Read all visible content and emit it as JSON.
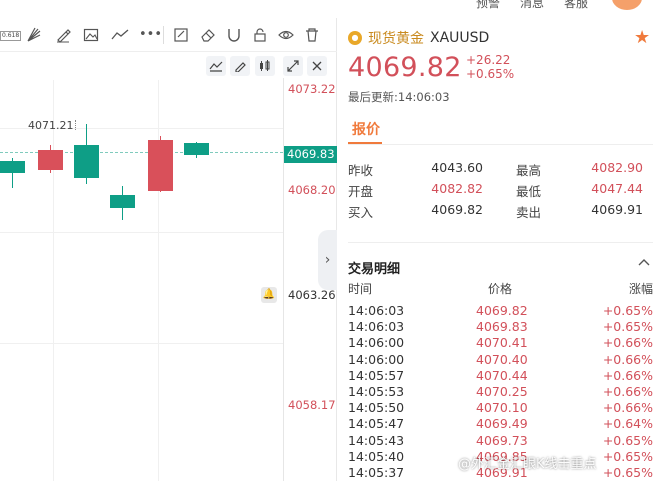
{
  "nav": {
    "items": [
      {
        "id": "forecast",
        "label": "预警"
      },
      {
        "id": "news",
        "label": "消息"
      },
      {
        "id": "service",
        "label": "客服"
      }
    ]
  },
  "toolbar": {
    "fib_label": "0.618"
  },
  "chart": {
    "axis_labels": [
      "4073.22",
      "4068.20",
      "4063.26",
      "4058.17"
    ],
    "last_price_tag": "4069.83",
    "high_annotation": "4071.21",
    "candles": [
      {
        "color": "up"
      },
      {
        "color": "down"
      },
      {
        "color": "up"
      },
      {
        "color": "up"
      },
      {
        "color": "down"
      },
      {
        "color": "up"
      }
    ]
  },
  "colors": {
    "up": "#0e9e86",
    "down": "#d9505a",
    "accent": "#f07a3c",
    "price_red": "#d2505a"
  },
  "quote": {
    "name": "现货黄金",
    "code": "XAUUSD",
    "price": "4069.82",
    "change": "+26.22",
    "change_pct": "+0.65%",
    "updated": "最后更新:14:06:03",
    "tab": "报价",
    "stats": [
      {
        "l1": "昨收",
        "v1": "4043.60",
        "l2": "最高",
        "v2": "4082.90",
        "c1": "dark",
        "c2": "red"
      },
      {
        "l1": "开盘",
        "v1": "4082.82",
        "l2": "最低",
        "v2": "4047.44",
        "c1": "red",
        "c2": "red"
      },
      {
        "l1": "买入",
        "v1": "4069.82",
        "l2": "卖出",
        "v2": "4069.91",
        "c1": "dark",
        "c2": "dark"
      }
    ],
    "trades_title": "交易明细",
    "trades_headers": {
      "time": "时间",
      "price": "价格",
      "chg": "涨幅"
    },
    "trades": [
      {
        "time": "14:06:03",
        "price": "4069.82",
        "chg": "+0.65%"
      },
      {
        "time": "14:06:03",
        "price": "4069.83",
        "chg": "+0.65%"
      },
      {
        "time": "14:06:00",
        "price": "4070.41",
        "chg": "+0.66%"
      },
      {
        "time": "14:06:00",
        "price": "4070.40",
        "chg": "+0.66%"
      },
      {
        "time": "14:05:57",
        "price": "4070.44",
        "chg": "+0.66%"
      },
      {
        "time": "14:05:53",
        "price": "4070.25",
        "chg": "+0.66%"
      },
      {
        "time": "14:05:50",
        "price": "4070.10",
        "chg": "+0.66%"
      },
      {
        "time": "14:05:47",
        "price": "4069.49",
        "chg": "+0.64%"
      },
      {
        "time": "14:05:43",
        "price": "4069.73",
        "chg": "+0.65%"
      },
      {
        "time": "14:05:40",
        "price": "4069.85",
        "chg": "+0.65%"
      },
      {
        "time": "14:05:37",
        "price": "4069.91",
        "chg": "+0.65%"
      }
    ]
  },
  "watermark": "@外汇金汇眼K线击重点"
}
